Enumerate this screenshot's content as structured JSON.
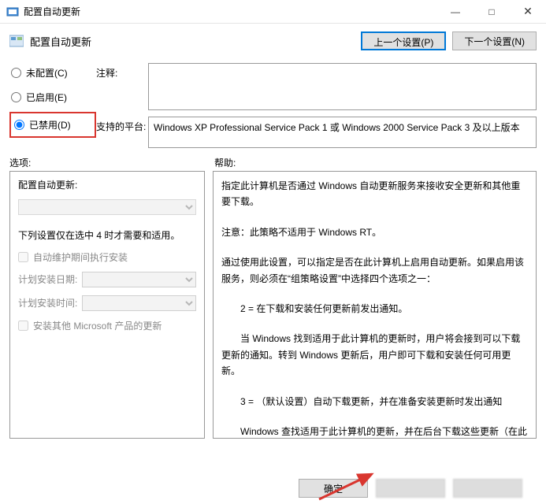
{
  "titlebar": {
    "title": "配置自动更新"
  },
  "header": {
    "title": "配置自动更新"
  },
  "nav": {
    "prev": "上一个设置(P)",
    "next": "下一个设置(N)"
  },
  "config": {
    "not_configured": "未配置(C)",
    "enabled": "已启用(E)",
    "disabled": "已禁用(D)",
    "comment_label": "注释:",
    "comment_value": "",
    "platform_label": "支持的平台:",
    "platform_value": "Windows XP Professional Service Pack 1 或 Windows 2000 Service Pack 3 及以上版本"
  },
  "mid": {
    "options_label": "选项:",
    "help_label": "帮助:"
  },
  "options_panel": {
    "group_title": "配置自动更新:",
    "subtitle": "下列设置仅在选中 4 时才需要和适用。",
    "chk1": "自动维护期间执行安装",
    "date_label": "计划安装日期:",
    "time_label": "计划安装时间:",
    "chk2": "安装其他 Microsoft 产品的更新"
  },
  "help": {
    "p1": "指定此计算机是否通过 Windows 自动更新服务来接收安全更新和其他重要下载。",
    "p2": "注意：此策略不适用于 Windows RT。",
    "p3": "通过使用此设置，可以指定是否在此计算机上启用自动更新。如果启用该服务，则必须在“组策略设置”中选择四个选项之一：",
    "p4": "2 = 在下载和安装任何更新前发出通知。",
    "p5": "当 Windows 找到适用于此计算机的更新时，用户将会接到可以下载更新的通知。转到 Windows 更新后，用户即可下载和安装任何可用更新。",
    "p6": "3 = （默认设置）自动下载更新，并在准备安装更新时发出通知",
    "p7": "Windows 查找适用于此计算机的更新，并在后台下载这些更新（在此过程中，用户不会收到通知或被打断工作）。完成下载后，用户将收到可以安装更新的通知。转到 Windows 更新后，"
  },
  "footer": {
    "ok": "确定"
  }
}
